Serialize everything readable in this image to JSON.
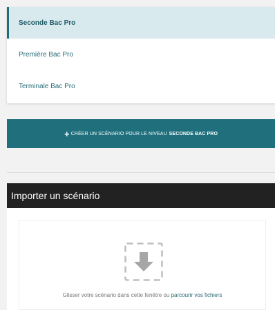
{
  "levels": [
    {
      "label": "Seconde Bac Pro",
      "active": true
    },
    {
      "label": "Première Bac Pro",
      "active": false
    },
    {
      "label": "Terminale Bac Pro",
      "active": false
    }
  ],
  "create_button": {
    "icon": "plus-icon",
    "prefix": "CRÉER UN SCÉNARIO POUR LE NIVEAU",
    "level": "SECONDE BAC PRO"
  },
  "import": {
    "title": "Importer un scénario",
    "dropzone": {
      "icon": "download-icon",
      "text": "Glisser votre scénario dans cette fenêtre ou",
      "link": "parcourir vos fichiers"
    }
  },
  "colors": {
    "accent": "#1f6f7d",
    "active_bg": "#d9eaee",
    "header_bg": "#222222",
    "page_bg": "#f2f2f2"
  }
}
